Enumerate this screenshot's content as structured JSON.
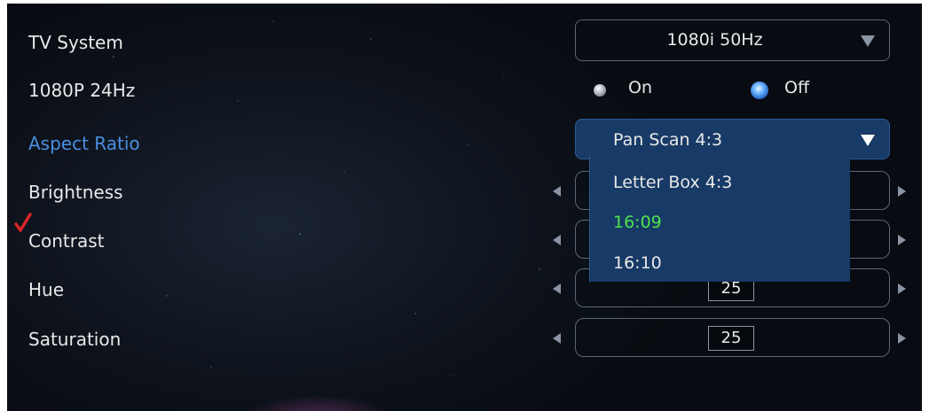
{
  "settings": {
    "tv_system": {
      "label": "TV System",
      "value": "1080i 50Hz"
    },
    "p24": {
      "label": "1080P 24Hz",
      "on_label": "On",
      "off_label": "Off",
      "selected": "Off"
    },
    "aspect_ratio": {
      "label": "Aspect Ratio",
      "value": "Pan Scan 4:3",
      "options": [
        "Pan Scan 4:3",
        "Letter Box 4:3",
        "16:09",
        "16:10"
      ],
      "current": "16:09"
    },
    "brightness": {
      "label": "Brightness"
    },
    "contrast": {
      "label": "Contrast"
    },
    "hue": {
      "label": "Hue",
      "value": "25"
    },
    "saturation": {
      "label": "Saturation",
      "value": "25"
    }
  },
  "colors": {
    "highlight": "#4a8fe0",
    "dropdown_bg": "#173a66",
    "current_option": "#4fe24f"
  },
  "icons": {
    "dropdown_arrow": "chevron-down-icon",
    "left_arrow": "arrow-left-icon",
    "right_arrow": "arrow-right-icon",
    "checkmark": "checkmark-icon"
  }
}
